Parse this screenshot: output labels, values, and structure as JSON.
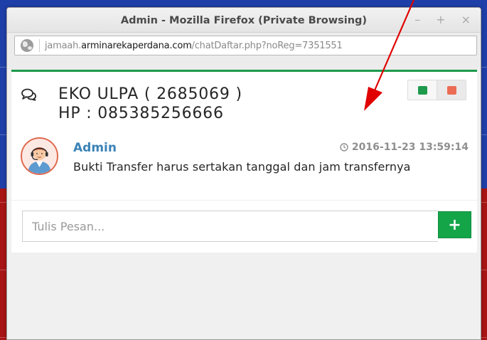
{
  "window": {
    "title": "Admin - Mozilla Firefox (Private Browsing)",
    "controls": {
      "minimize": "–",
      "maximize": "+",
      "close": "×"
    }
  },
  "address_bar": {
    "url_prefix": "jamaah.",
    "url_domain": "arminarekaperdana.com",
    "url_path": "/chatDaftar.php?noReg=7351551"
  },
  "chat": {
    "contact_name": "EKO ULPA ( 2685069 )",
    "contact_phone": "HP : 085385256666",
    "toggle_colors": {
      "green": "#1d9a4c",
      "red": "#ec6b55"
    },
    "messages": [
      {
        "sender": "Admin",
        "timestamp": "2016-11-23 13:59:14",
        "text": "Bukti Transfer harus sertakan tanggal dan jam transfernya"
      }
    ],
    "input": {
      "placeholder": "Tulis Pesan...",
      "send_label": "+"
    }
  },
  "colors": {
    "accent_green": "#1d9a4c",
    "sender_blue": "#3a83b7",
    "annotation_arrow": "#e00000"
  }
}
